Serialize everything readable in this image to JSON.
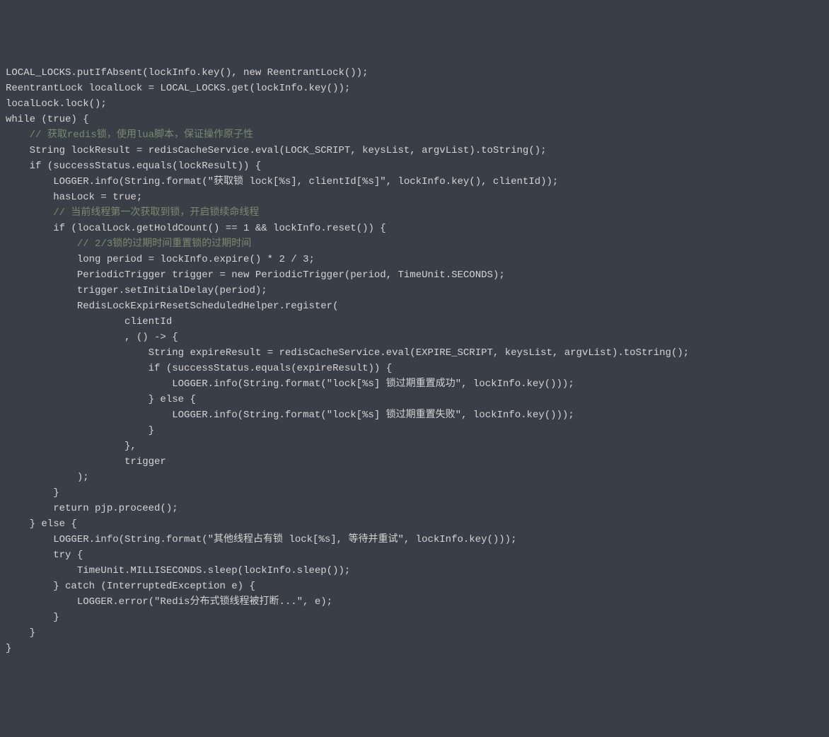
{
  "code_lines": [
    "LOCAL_LOCKS.putIfAbsent(lockInfo.key(), new ReentrantLock());",
    "ReentrantLock localLock = LOCAL_LOCKS.get(lockInfo.key());",
    "localLock.lock();",
    "while (true) {",
    "    // 获取redis锁，使用lua脚本，保证操作原子性",
    "    String lockResult = redisCacheService.eval(LOCK_SCRIPT, keysList, argvList).toString();",
    "    if (successStatus.equals(lockResult)) {",
    "        LOGGER.info(String.format(\"获取锁 lock[%s], clientId[%s]\", lockInfo.key(), clientId));",
    "        hasLock = true;",
    "",
    "        // 当前线程第一次获取到锁，开启锁续命线程",
    "        if (localLock.getHoldCount() == 1 && lockInfo.reset()) {",
    "            // 2/3锁的过期时间重置锁的过期时间",
    "            long period = lockInfo.expire() * 2 / 3;",
    "            PeriodicTrigger trigger = new PeriodicTrigger(period, TimeUnit.SECONDS);",
    "            trigger.setInitialDelay(period);",
    "            RedisLockExpirResetScheduledHelper.register(",
    "                    clientId",
    "                    , () -> {",
    "                        String expireResult = redisCacheService.eval(EXPIRE_SCRIPT, keysList, argvList).toString();",
    "                        if (successStatus.equals(expireResult)) {",
    "                            LOGGER.info(String.format(\"lock[%s] 锁过期重置成功\", lockInfo.key()));",
    "                        } else {",
    "                            LOGGER.info(String.format(\"lock[%s] 锁过期重置失败\", lockInfo.key()));",
    "                        }",
    "                    },",
    "                    trigger",
    "            );",
    "        }",
    "        return pjp.proceed();",
    "    } else {",
    "        LOGGER.info(String.format(\"其他线程占有锁 lock[%s], 等待并重试\", lockInfo.key()));",
    "        try {",
    "            TimeUnit.MILLISECONDS.sleep(lockInfo.sleep());",
    "        } catch (InterruptedException e) {",
    "            LOGGER.error(\"Redis分布式锁线程被打断...\", e);",
    "        }",
    "    }",
    "}"
  ],
  "comment_line_indices": [
    4,
    10,
    12
  ]
}
